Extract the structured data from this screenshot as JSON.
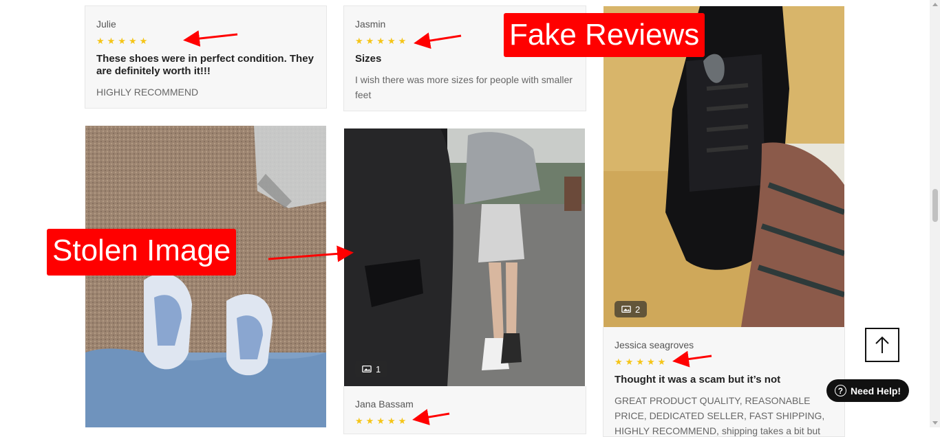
{
  "reviews": [
    {
      "name": "Julie",
      "rating": 5,
      "title": "These shoes were in perfect condition. They are definitely worth it!!!",
      "text": "HIGHLY RECOMMEND"
    },
    {
      "name": "Jasmin",
      "rating": 5,
      "title": "Sizes",
      "text": "I wish there was more sizes for people with smaller feet"
    },
    {
      "name": "Jana Bassam",
      "rating": 5,
      "photo_count": "1"
    },
    {
      "name": "Jessica seagroves",
      "rating": 5,
      "photo_count": "2",
      "title": "Thought it was a scam but it’s not",
      "text": "GREAT PRODUCT QUALITY, REASONABLE PRICE, DEDICATED SELLER, FAST SHIPPING, HIGHLY RECOMMEND, shipping takes a bit but you'll be so"
    }
  ],
  "annotations": {
    "fake_reviews": "Fake Reviews",
    "stolen_image": "Stolen Image"
  },
  "widgets": {
    "need_help": "Need Help!",
    "help_glyph": "?"
  },
  "colors": {
    "star": "#f5c518",
    "annotation": "#ff0000"
  },
  "icons": {
    "badge": "image-icon",
    "top": "arrow-up-icon"
  }
}
